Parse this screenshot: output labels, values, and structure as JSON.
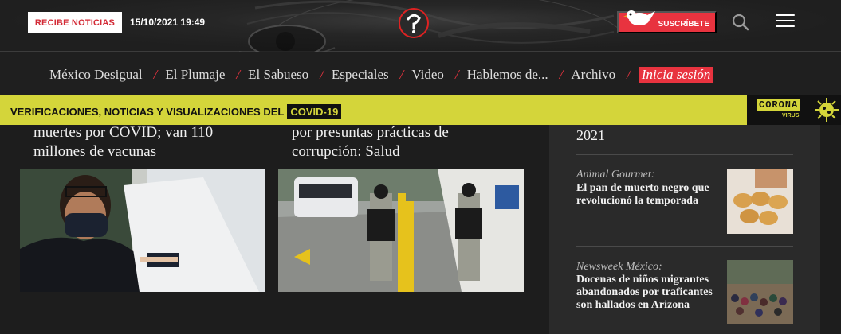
{
  "header": {
    "notify_label": "RECIBE NOTICIAS",
    "datetime": "15/10/2021 19:49",
    "subscribe_label": "SUSCRÍBETE",
    "icons": {
      "logo": "animal-politico-logo",
      "search": "search-icon",
      "menu": "hamburger-menu-icon"
    }
  },
  "nav": {
    "items": [
      "México Desigual",
      "El Plumaje",
      "El Sabueso",
      "Especiales",
      "Video",
      "Hablemos de...",
      "Archivo"
    ],
    "login_label": "Inicia sesión",
    "separator": "/"
  },
  "covid_bar": {
    "text": "VERIFICACIONES, NOTICIAS Y VISUALIZACIONES DEL",
    "badge": "COVID-19",
    "logo_word": "CORONA",
    "logo_sub": "VIRUS"
  },
  "articles": [
    {
      "title_line1": "muertes por COVID; van 110",
      "title_line2": "millones de vacunas"
    },
    {
      "title_line1": "por presuntas prácticas de",
      "title_line2": "corrupción: Salud"
    }
  ],
  "sidebar": {
    "top_fragment": "2021",
    "items": [
      {
        "source": "Animal Gourmet:",
        "title": "El pan de muerto negro que revolucionó la temporada"
      },
      {
        "source": "Newsweek México:",
        "title": "Docenas de niños migrantes abandonados por traficantes son hallados en Arizona"
      }
    ]
  },
  "colors": {
    "accent_red": "#e8333f",
    "covid_yellow": "#d4d53a",
    "background": "#1d1d1d"
  }
}
